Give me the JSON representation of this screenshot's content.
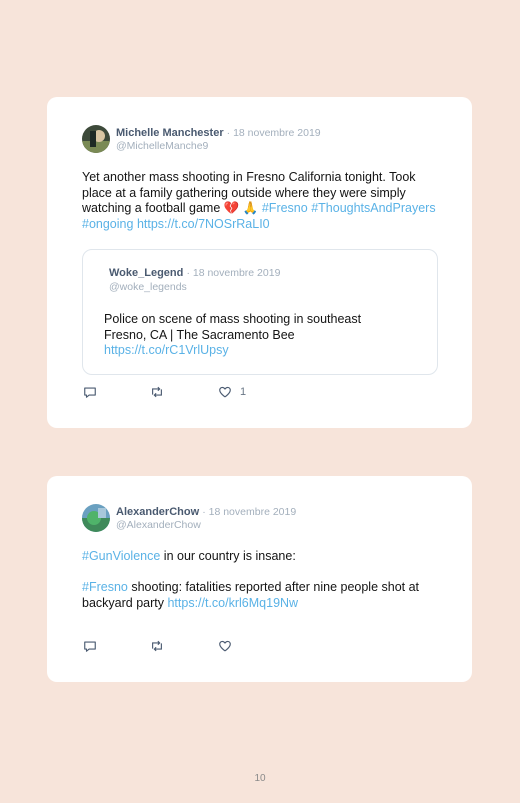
{
  "tweets": [
    {
      "author": "Michelle Manchester",
      "date": "· 18 novembre 2019",
      "handle": "@MichelleManche9",
      "text_plain": "Yet another mass shooting in Fresno California tonight. Took place at a family gathering outside where they were simply watching a football game",
      "emoji": "💔 🙏",
      "hashtag1": "#Fresno",
      "hashtag2": "#ThoughtsAndPrayers",
      "hashtag3": "#ongoing",
      "link": "https://t.co/7NOSrRaLI0",
      "quote": {
        "author": "Woke_Legend",
        "date": "· 18 novembre 2019",
        "handle": "@woke_legends",
        "text": "Police on scene of mass shooting in southeast Fresno, CA | The Sacramento Bee",
        "link": "https://t.co/rC1VrlUpsy"
      },
      "likes": "1"
    },
    {
      "author": "AlexanderChow",
      "date": "· 18 novembre 2019",
      "handle": "@AlexanderChow",
      "hashtag1": "#GunViolence",
      "text1": " in our country is insane:",
      "hashtag2": "#Fresno",
      "text2": " shooting: fatalities reported after nine people shot at backyard party",
      "link": "https://t.co/krl6Mq19Nw"
    }
  ],
  "page_number": "10",
  "colors": {
    "background": "#f7e4da",
    "card": "#ffffff",
    "link": "#5ab2e6",
    "muted": "#a3afbc"
  },
  "icons": [
    "reply-icon",
    "retweet-icon",
    "like-icon"
  ]
}
